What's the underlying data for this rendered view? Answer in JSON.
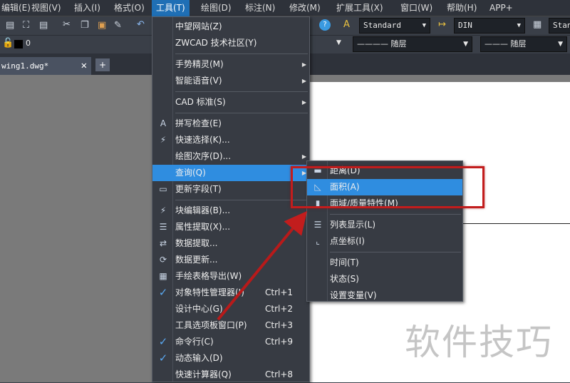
{
  "menubar": [
    "编辑(E)",
    "视图(V)",
    "插入(I)",
    "格式(O)",
    "工具(T)",
    "绘图(D)",
    "标注(N)",
    "修改(M)",
    "扩展工具(X)",
    "窗口(W)",
    "帮助(H)",
    "APP+"
  ],
  "active_menu": "工具(T)",
  "toolbar": {
    "text_style": "Standard",
    "dim_style": "DIN",
    "table_style": "Standard",
    "layer": "0",
    "linetype": "———— 随层",
    "lineweight": "——— 随层"
  },
  "tab": {
    "label": "wing1.dwg*",
    "close": "✕",
    "new": "+"
  },
  "tools_menu": [
    {
      "label": "中望网站(Z)"
    },
    {
      "label": "ZWCAD 技术社区(Y)"
    },
    {
      "sep": true
    },
    {
      "label": "手势精灵(M)",
      "sub": true
    },
    {
      "label": "智能语音(V)",
      "sub": true
    },
    {
      "sep": true
    },
    {
      "label": "CAD 标准(S)",
      "sub": true
    },
    {
      "sep": true
    },
    {
      "label": "拼写检查(E)",
      "icon": "spell-check-icon"
    },
    {
      "label": "快速选择(K)...",
      "icon": "quick-select-icon"
    },
    {
      "label": "绘图次序(D)...",
      "sub": true
    },
    {
      "label": "查询(Q)",
      "sub": true,
      "highlighted": true
    },
    {
      "label": "更新字段(T)",
      "icon": "update-field-icon"
    },
    {
      "sep": true
    },
    {
      "label": "块编辑器(B)...",
      "icon": "block-editor-icon"
    },
    {
      "label": "属性提取(X)...",
      "icon": "attribute-extract-icon"
    },
    {
      "label": "数据提取...",
      "icon": "data-extract-icon"
    },
    {
      "label": "数据更新...",
      "icon": "data-update-icon"
    },
    {
      "label": "手绘表格导出(W)",
      "icon": "table-export-icon"
    },
    {
      "label": "对象特性管理器(I)",
      "shortcut": "Ctrl+1",
      "checked": true
    },
    {
      "label": "设计中心(G)",
      "shortcut": "Ctrl+2"
    },
    {
      "label": "工具选项板窗口(P)",
      "shortcut": "Ctrl+3"
    },
    {
      "label": "命令行(C)",
      "shortcut": "Ctrl+9",
      "checked": true
    },
    {
      "label": "动态输入(D)",
      "checked": true
    },
    {
      "label": "快速计算器(Q)",
      "shortcut": "Ctrl+8"
    }
  ],
  "query_menu": [
    {
      "label": "距离(D)",
      "icon": "distance-icon"
    },
    {
      "label": "面积(A)",
      "icon": "area-icon",
      "highlighted": true
    },
    {
      "label": "面域/质量特性(M)",
      "icon": "mass-properties-icon"
    },
    {
      "sep": true
    },
    {
      "label": "列表显示(L)",
      "icon": "list-icon"
    },
    {
      "label": "点坐标(I)",
      "icon": "point-coordinate-icon"
    },
    {
      "sep": true
    },
    {
      "label": "时间(T)"
    },
    {
      "label": "状态(S)"
    },
    {
      "label": "设置变量(V)"
    }
  ],
  "watermark": "软件技巧",
  "colors": {
    "highlight": "#2f8de0",
    "annotation": "#c21d1d"
  }
}
